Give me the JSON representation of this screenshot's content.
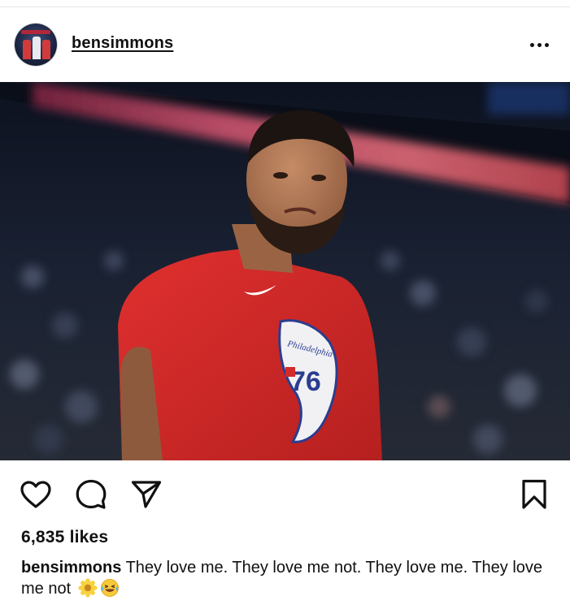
{
  "post": {
    "username": "bensimmons",
    "more_icon": "more-horizontal-icon",
    "photo_subject": "player-photo"
  },
  "actions": {
    "like_icon": "heart-icon",
    "comment_icon": "comment-icon",
    "share_icon": "send-icon",
    "save_icon": "bookmark-icon"
  },
  "likes": {
    "text": "6,835 likes"
  },
  "caption": {
    "username": "bensimmons",
    "text": "They love me. They love me not. They love me. They love me not",
    "emojis": [
      "🌼",
      "😂"
    ]
  },
  "colors": {
    "text": "#111111",
    "jersey_red": "#d32a2a",
    "divider": "#e6e6e6"
  }
}
